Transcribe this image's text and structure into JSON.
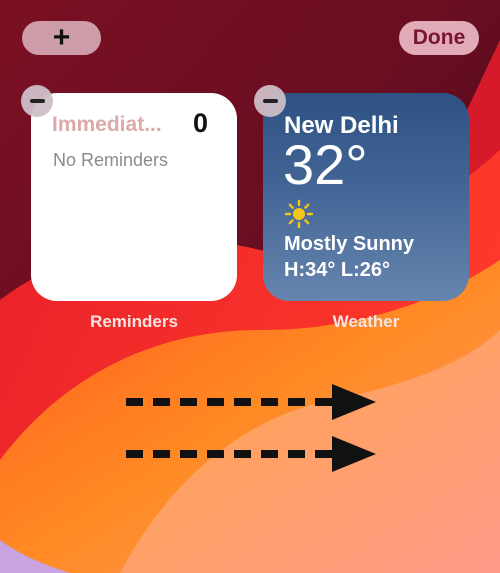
{
  "toolbar": {
    "add_label": "+",
    "done_label": "Done"
  },
  "widgets": {
    "reminders": {
      "list_name": "Immediat...",
      "count": "0",
      "empty_text": "No Reminders",
      "caption": "Reminders",
      "title_color": "#dba9a9"
    },
    "weather": {
      "city": "New Delhi",
      "temperature": "32°",
      "condition_icon": "sun-icon",
      "condition": "Mostly Sunny",
      "high_low": "H:34° L:26°",
      "caption": "Weather"
    }
  },
  "colors": {
    "accent_done": "#7a1530",
    "weather_bg": "#2e5183",
    "sun": "#f5c518"
  }
}
